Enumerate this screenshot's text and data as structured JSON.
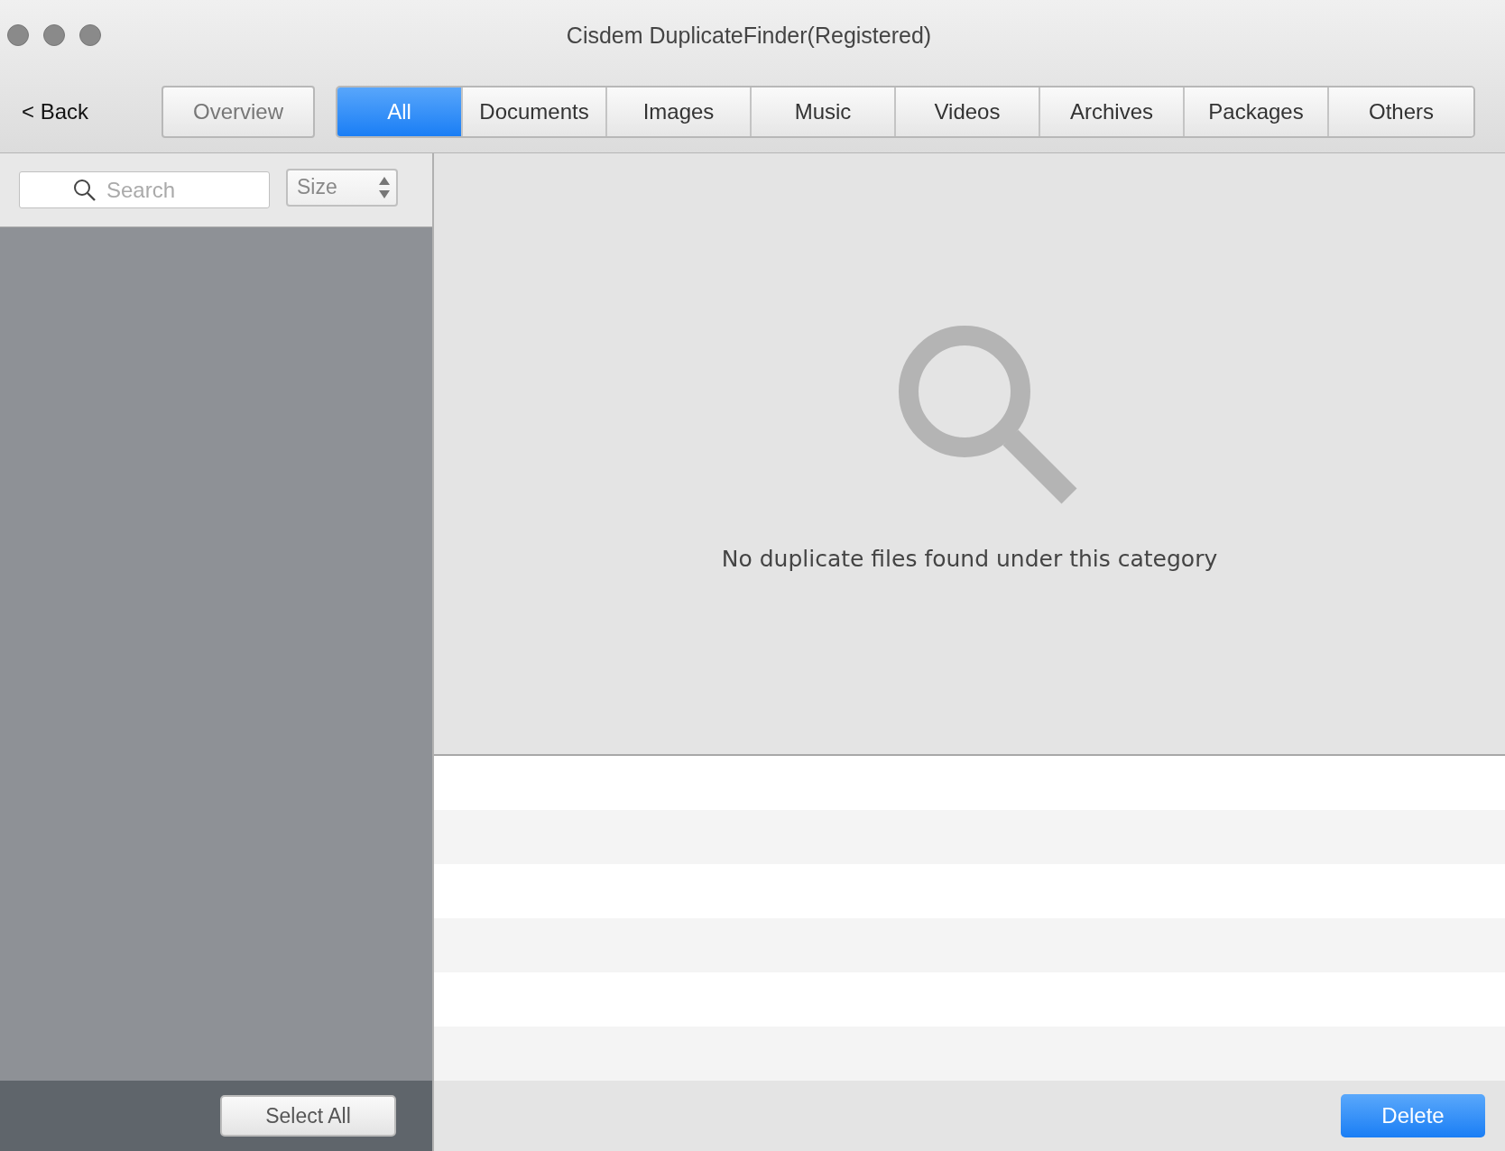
{
  "window": {
    "title": "Cisdem DuplicateFinder(Registered)"
  },
  "toolbar": {
    "back": "< Back",
    "overview": "Overview"
  },
  "tabs": [
    {
      "label": "All",
      "selected": true
    },
    {
      "label": "Documents",
      "selected": false
    },
    {
      "label": "Images",
      "selected": false
    },
    {
      "label": "Music",
      "selected": false
    },
    {
      "label": "Videos",
      "selected": false
    },
    {
      "label": "Archives",
      "selected": false
    },
    {
      "label": "Packages",
      "selected": false
    },
    {
      "label": "Others",
      "selected": false
    }
  ],
  "sidebar": {
    "search": {
      "placeholder": "Search"
    },
    "sort": {
      "value": "Size"
    },
    "select_all": "Select All"
  },
  "main": {
    "empty_message": "No duplicate files found under this category",
    "delete": "Delete"
  }
}
